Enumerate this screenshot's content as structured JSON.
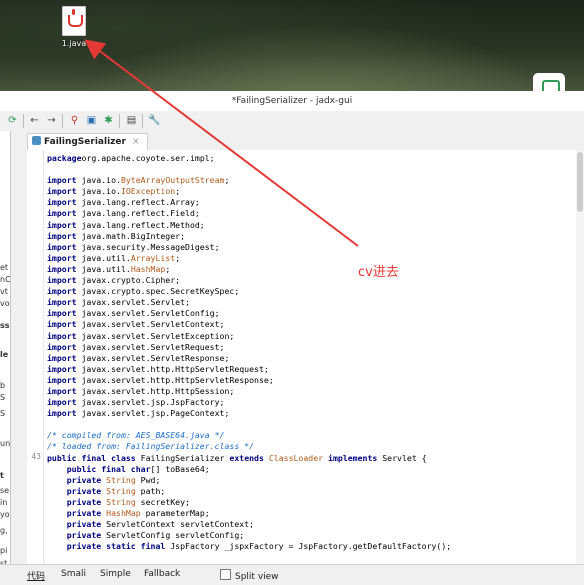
{
  "desktop": {
    "file_icon_label": "1.java"
  },
  "window": {
    "title": "*FailingSerializer - jadx-gui"
  },
  "tab": {
    "label": "FailingSerializer",
    "close_glyph": "×"
  },
  "left_panel_fragments": [
    "et",
    "nC",
    "vt",
    "vo",
    "ss",
    "le",
    "b",
    "S",
    "S",
    "un",
    "t",
    "se",
    "in",
    "yo",
    "g,",
    "pi",
    "st",
    "诸"
  ],
  "gutter_line_number": "43",
  "code_lines": [
    [
      [
        "kw",
        "package"
      ],
      [
        "",
        "org.apache.coyote.ser.impl;"
      ]
    ],
    [],
    [
      [
        "kw",
        "import"
      ],
      [
        "",
        " java.io."
      ],
      [
        "ty",
        "ByteArrayOutputStream"
      ],
      [
        "",
        ";"
      ]
    ],
    [
      [
        "kw",
        "import"
      ],
      [
        "",
        " java.io."
      ],
      [
        "ty",
        "IOException"
      ],
      [
        "",
        ";"
      ]
    ],
    [
      [
        "kw",
        "import"
      ],
      [
        "",
        " java.lang.reflect.Array;"
      ]
    ],
    [
      [
        "kw",
        "import"
      ],
      [
        "",
        " java.lang.reflect.Field;"
      ]
    ],
    [
      [
        "kw",
        "import"
      ],
      [
        "",
        " java.lang.reflect.Method;"
      ]
    ],
    [
      [
        "kw",
        "import"
      ],
      [
        "",
        " java.math.BigInteger;"
      ]
    ],
    [
      [
        "kw",
        "import"
      ],
      [
        "",
        " java.security.MessageDigest;"
      ]
    ],
    [
      [
        "kw",
        "import"
      ],
      [
        "",
        " java.util."
      ],
      [
        "ty",
        "ArrayList"
      ],
      [
        "",
        ";"
      ]
    ],
    [
      [
        "kw",
        "import"
      ],
      [
        "",
        " java.util."
      ],
      [
        "ty",
        "HashMap"
      ],
      [
        "",
        ";"
      ]
    ],
    [
      [
        "kw",
        "import"
      ],
      [
        "",
        " javax.crypto.Cipher;"
      ]
    ],
    [
      [
        "kw",
        "import"
      ],
      [
        "",
        " javax.crypto.spec.SecretKeySpec;"
      ]
    ],
    [
      [
        "kw",
        "import"
      ],
      [
        "",
        " javax.servlet.Servlet;"
      ]
    ],
    [
      [
        "kw",
        "import"
      ],
      [
        "",
        " javax.servlet.ServletConfig;"
      ]
    ],
    [
      [
        "kw",
        "import"
      ],
      [
        "",
        " javax.servlet.ServletContext;"
      ]
    ],
    [
      [
        "kw",
        "import"
      ],
      [
        "",
        " javax.servlet.ServletException;"
      ]
    ],
    [
      [
        "kw",
        "import"
      ],
      [
        "",
        " javax.servlet.ServletRequest;"
      ]
    ],
    [
      [
        "kw",
        "import"
      ],
      [
        "",
        " javax.servlet.ServletResponse;"
      ]
    ],
    [
      [
        "kw",
        "import"
      ],
      [
        "",
        " javax.servlet.http.HttpServletRequest;"
      ]
    ],
    [
      [
        "kw",
        "import"
      ],
      [
        "",
        " javax.servlet.http.HttpServletResponse;"
      ]
    ],
    [
      [
        "kw",
        "import"
      ],
      [
        "",
        " javax.servlet.http.HttpSession;"
      ]
    ],
    [
      [
        "kw",
        "import"
      ],
      [
        "",
        " javax.servlet.jsp.JspFactory;"
      ]
    ],
    [
      [
        "kw",
        "import"
      ],
      [
        "",
        " javax.servlet.jsp.PageContext;"
      ]
    ],
    [],
    [
      [
        "cm",
        "/* compiled from: AES_BASE64.java */"
      ]
    ],
    [
      [
        "cm",
        "/* loaded from: FailingSerializer.class */"
      ]
    ],
    [
      [
        "kw",
        "public final class"
      ],
      [
        "",
        " FailingSerializer "
      ],
      [
        "kw",
        "extends"
      ],
      [
        "",
        " "
      ],
      [
        "ty",
        "ClassLoader"
      ],
      [
        "",
        " "
      ],
      [
        "kw",
        "implements"
      ],
      [
        "",
        " Servlet {"
      ]
    ],
    [
      [
        "",
        "    "
      ],
      [
        "kw",
        "public final char"
      ],
      [
        "",
        "[] toBase64;"
      ]
    ],
    [
      [
        "",
        "    "
      ],
      [
        "kw",
        "private"
      ],
      [
        "",
        " "
      ],
      [
        "ty",
        "String"
      ],
      [
        "",
        " Pwd;"
      ]
    ],
    [
      [
        "",
        "    "
      ],
      [
        "kw",
        "private"
      ],
      [
        "",
        " "
      ],
      [
        "ty",
        "String"
      ],
      [
        "",
        " path;"
      ]
    ],
    [
      [
        "",
        "    "
      ],
      [
        "kw",
        "private"
      ],
      [
        "",
        " "
      ],
      [
        "ty",
        "String"
      ],
      [
        "",
        " secretKey;"
      ]
    ],
    [
      [
        "",
        "    "
      ],
      [
        "kw",
        "private"
      ],
      [
        "",
        " "
      ],
      [
        "ty",
        "HashMap"
      ],
      [
        "",
        " parameterMap;"
      ]
    ],
    [
      [
        "",
        "    "
      ],
      [
        "kw",
        "private"
      ],
      [
        "",
        " ServletContext servletContext;"
      ]
    ],
    [
      [
        "",
        "    "
      ],
      [
        "kw",
        "private"
      ],
      [
        "",
        " ServletConfig servletConfig;"
      ]
    ],
    [
      [
        "",
        "    "
      ],
      [
        "kw",
        "private static final"
      ],
      [
        "",
        " JspFactory _jspxFactory = JspFactory.getDefaultFactory();"
      ]
    ]
  ],
  "bottom_tabs": [
    "代码",
    "Smali",
    "Simple",
    "Fallback"
  ],
  "split_view_label": "Split view",
  "annotation": {
    "text": "cv进去",
    "color": "#e53935"
  },
  "colors": {
    "keyword": "#000080",
    "type": "#b05a1a",
    "comment": "#1a6ec7"
  }
}
